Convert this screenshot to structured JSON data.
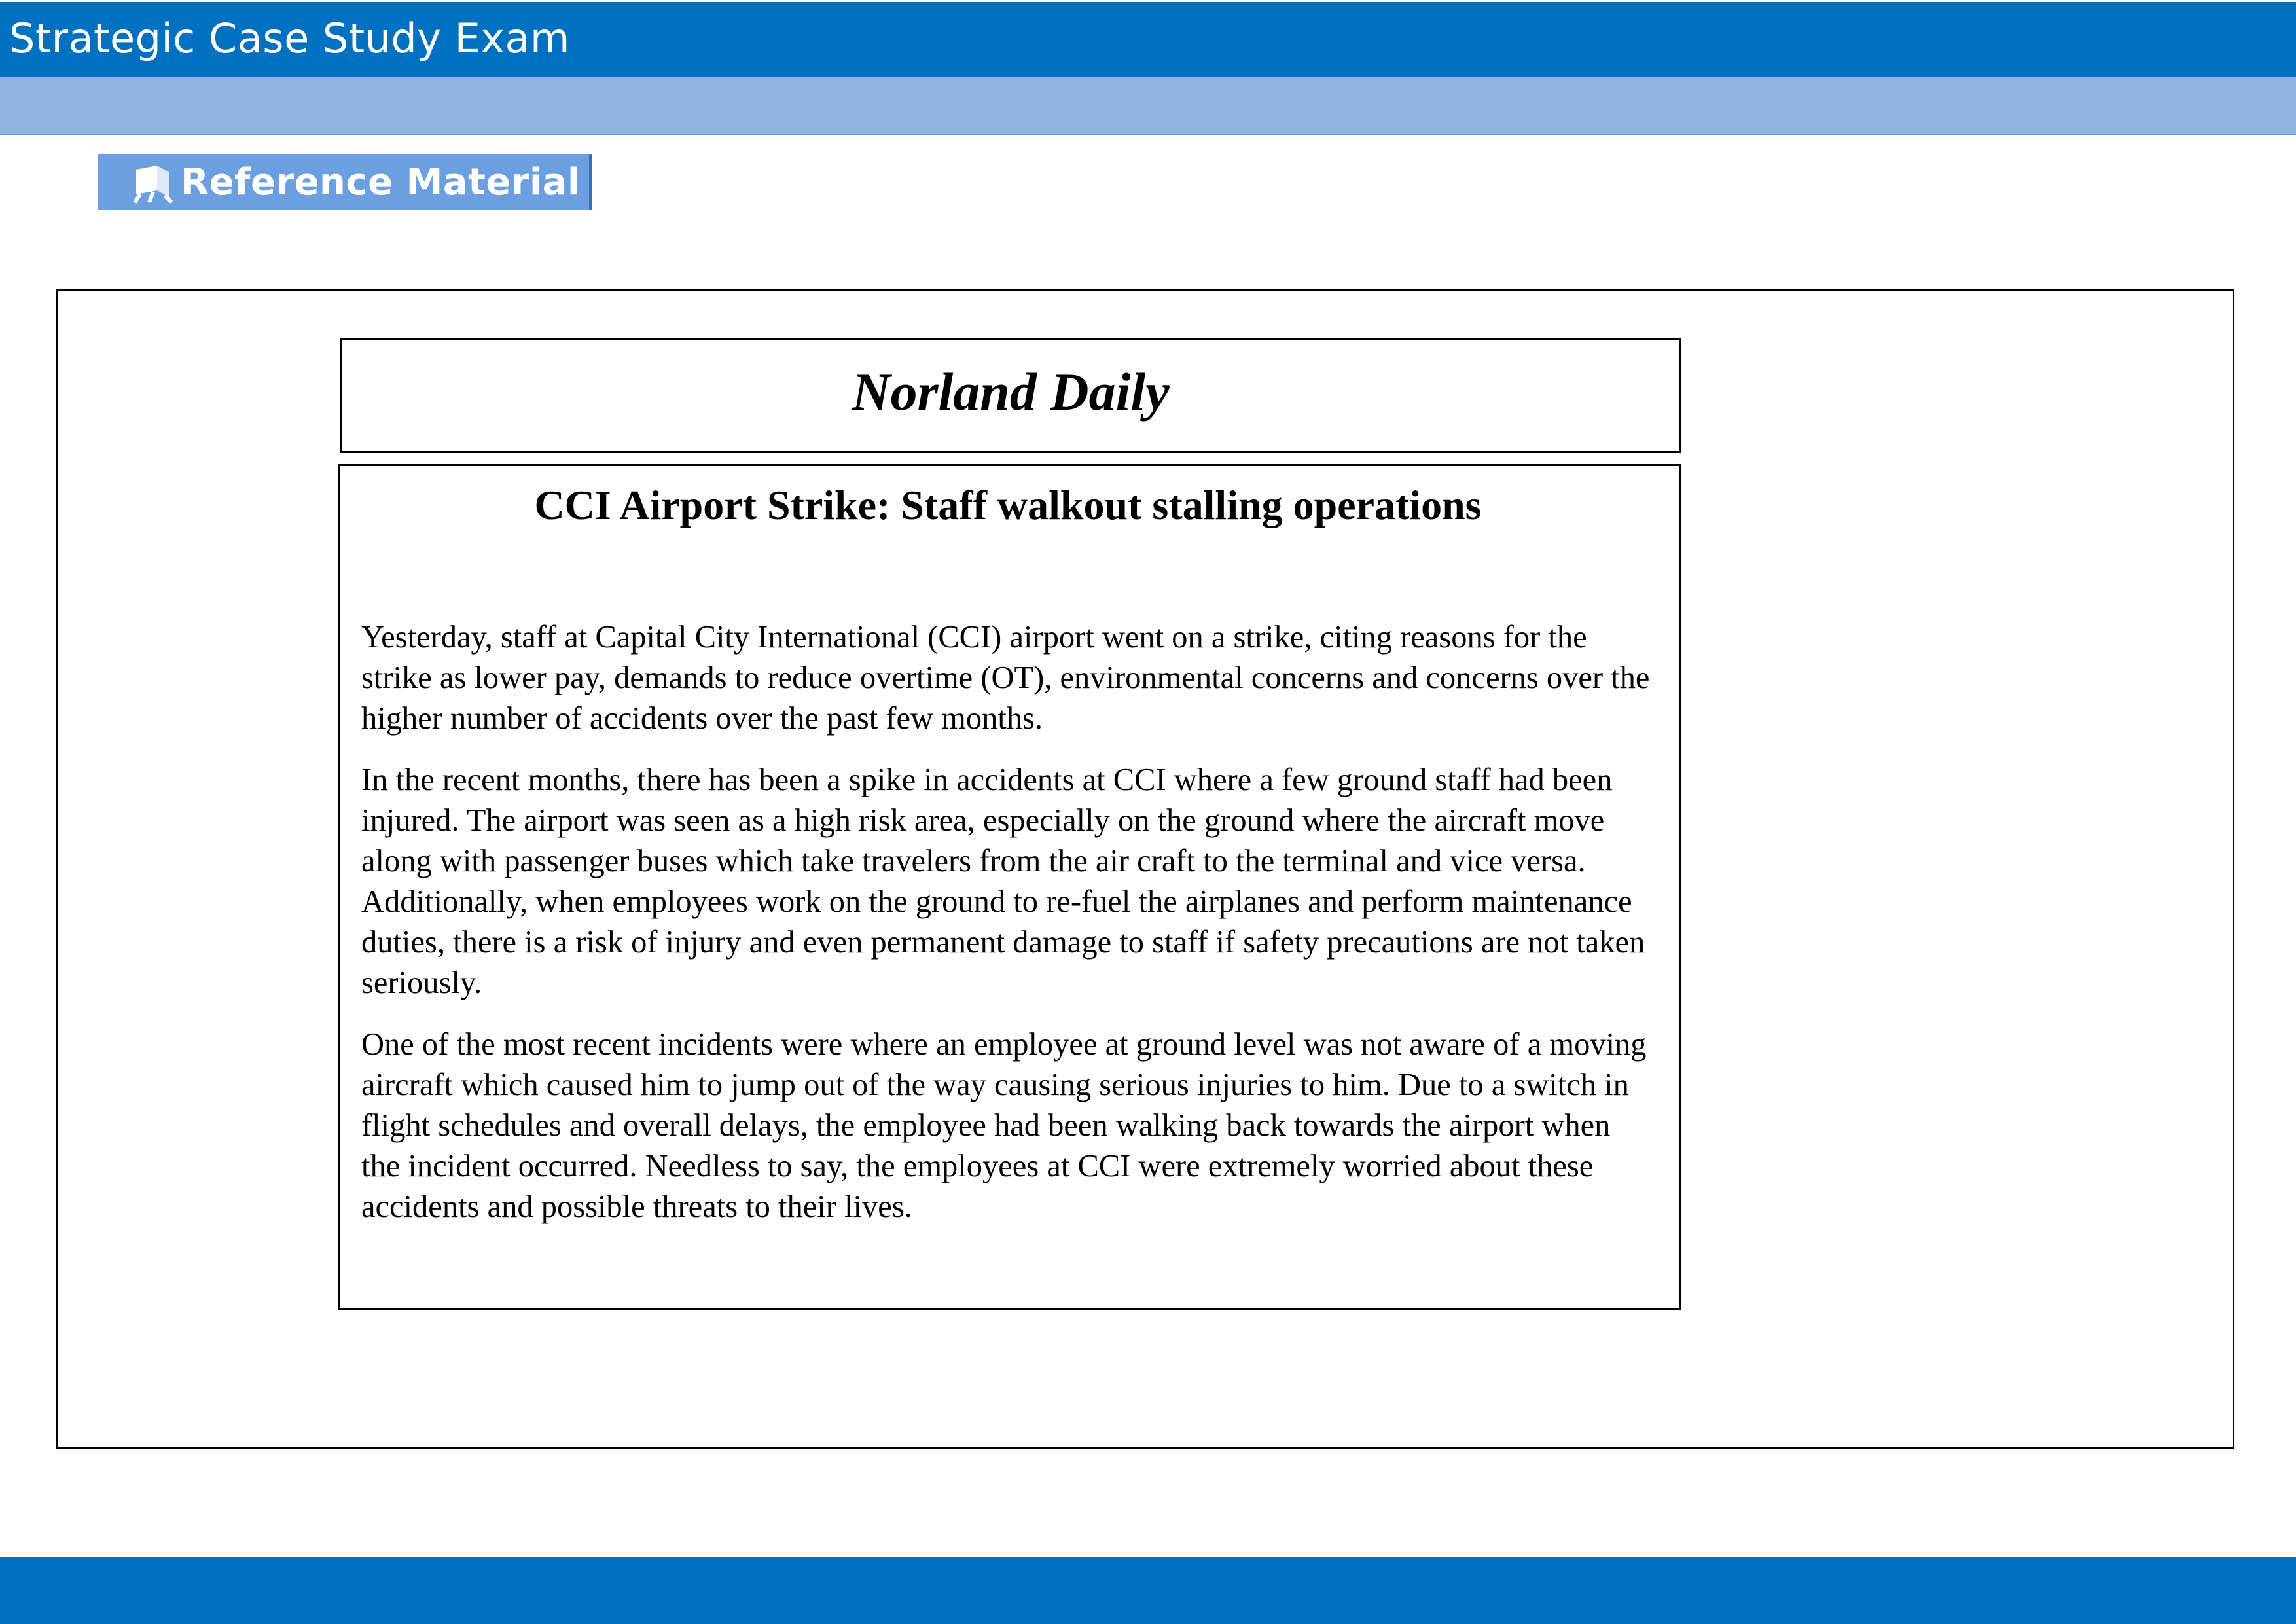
{
  "header": {
    "title": "Strategic Case Study Exam"
  },
  "toolbar": {
    "reference_label": "Reference Material",
    "reference_icon": "book-stand-icon"
  },
  "newspaper": {
    "name": "Norland Daily",
    "headline": "CCI Airport Strike: Staff walkout stalling operations",
    "paragraphs": [
      "Yesterday, staff at Capital City International (CCI) airport went on a strike, citing reasons for the strike as lower pay, demands to reduce overtime (OT), environmental concerns and concerns over the higher number of accidents over the past few months.",
      "In the recent months, there has been a spike in accidents at CCI where a few ground staff had been injured. The airport was seen as a high risk area, especially on the ground where the aircraft move along with passenger buses which take travelers from the air craft to the terminal and vice versa. Additionally, when employees work on the ground to re-fuel the airplanes and perform maintenance duties, there is a risk of injury and even permanent damage to staff if safety precautions are not taken seriously.",
      "One of the most recent incidents were where an employee at ground level was not aware of a moving aircraft which caused him to jump out of the way causing serious injuries to him. Due to a switch in flight schedules and overall delays, the employee had been walking back towards the airport when the incident occurred. Needless to say, the employees at CCI were extremely worried about these accidents and possible threats to their lives."
    ]
  },
  "colors": {
    "header_blue": "#0070c0",
    "subbar_blue": "#8db4e3",
    "button_blue": "#6b9fe0"
  }
}
